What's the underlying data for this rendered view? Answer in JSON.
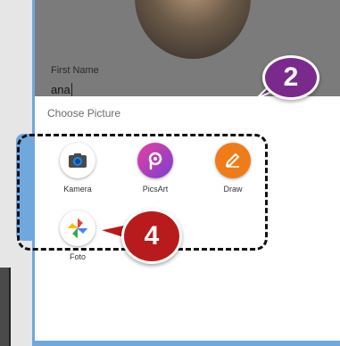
{
  "form": {
    "first_name_label": "First Name",
    "first_name_value": "ana"
  },
  "sheet": {
    "title": "Choose Picture",
    "apps": [
      {
        "label": "Kamera",
        "icon": "camera-icon",
        "color": "#ffffff"
      },
      {
        "label": "PicsArt",
        "icon": "picsart-icon",
        "color": "#b43fd0"
      },
      {
        "label": "Draw",
        "icon": "pencil-icon",
        "color": "#ef7c1a"
      },
      {
        "label": "Foto",
        "icon": "photos-pinwheel-icon",
        "color": "#ffffff"
      }
    ]
  },
  "annotations": {
    "step_2": "2",
    "step_4": "4",
    "marker_2_color": "#7a2a8c",
    "marker_4_color": "#b81b1b",
    "highlight_color": "#6fa8dc"
  }
}
